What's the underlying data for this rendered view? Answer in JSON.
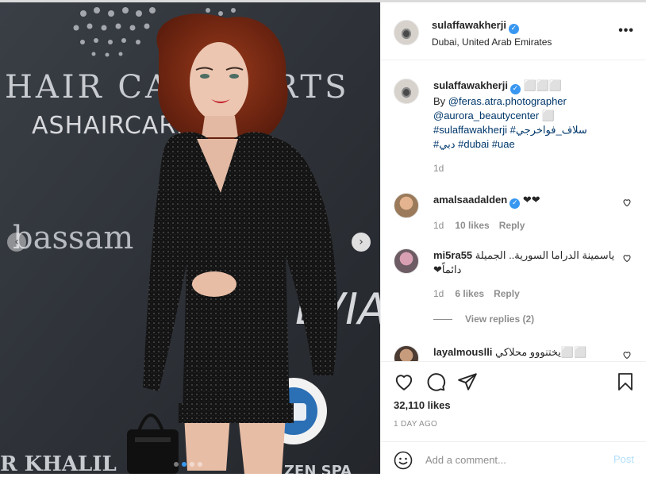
{
  "post": {
    "author": {
      "username": "sulaffawakherji",
      "verified": true,
      "location": "Dubai, United Arab Emirates"
    },
    "media": {
      "backdrop_texts": [
        "HAIR CAR",
        "RTS",
        "ASHAIRCARE",
        "bassam",
        "R KHALIL",
        "ZEN SPA",
        "LVIA"
      ],
      "slide_count": 4,
      "active_slide": 2,
      "colors": {
        "backdrop": "#30343a",
        "dress": "#151515",
        "hair": "#7a2a16",
        "active_dot": "#3897f0"
      }
    },
    "caption": {
      "username": "sulaffawakherji",
      "emoji": "⬜⬜⬜",
      "by_label": "By ",
      "mention_1": "@feras.atra.photographer",
      "mention_2": "@aurora_beautycenter",
      "mention_2_suffix": " ⬜",
      "hashtag_1": "#sulaffawakherji",
      "hashtag_2": "#سلاف_فواخرجي",
      "hashtag_3": "#دبي",
      "hashtag_4": "#dubai",
      "hashtag_5": "#uae",
      "time": "1d"
    },
    "comments": [
      {
        "username": "amalsaadalden",
        "verified": true,
        "text": "❤❤",
        "time": "1d",
        "likes": "10 likes",
        "reply": "Reply"
      },
      {
        "username": "mi5ra55",
        "verified": false,
        "text": "ياسمينة الدراما السورية.. الجميلة دائماً❤",
        "time": "1d",
        "likes": "6 likes",
        "reply": "Reply",
        "view_replies": "View replies (2)"
      },
      {
        "username": "layalmouslli",
        "verified": false,
        "text": "يختنووو محلاكي⬜⬜"
      }
    ],
    "actions": {
      "icons": [
        "heart-icon",
        "comment-icon",
        "share-icon",
        "bookmark-icon"
      ],
      "likes": "32,110 likes",
      "date": "1 DAY AGO"
    },
    "add_comment": {
      "placeholder": "Add a comment...",
      "post_label": "Post",
      "post_color": "#b2dffc"
    },
    "more_label": "•••"
  }
}
